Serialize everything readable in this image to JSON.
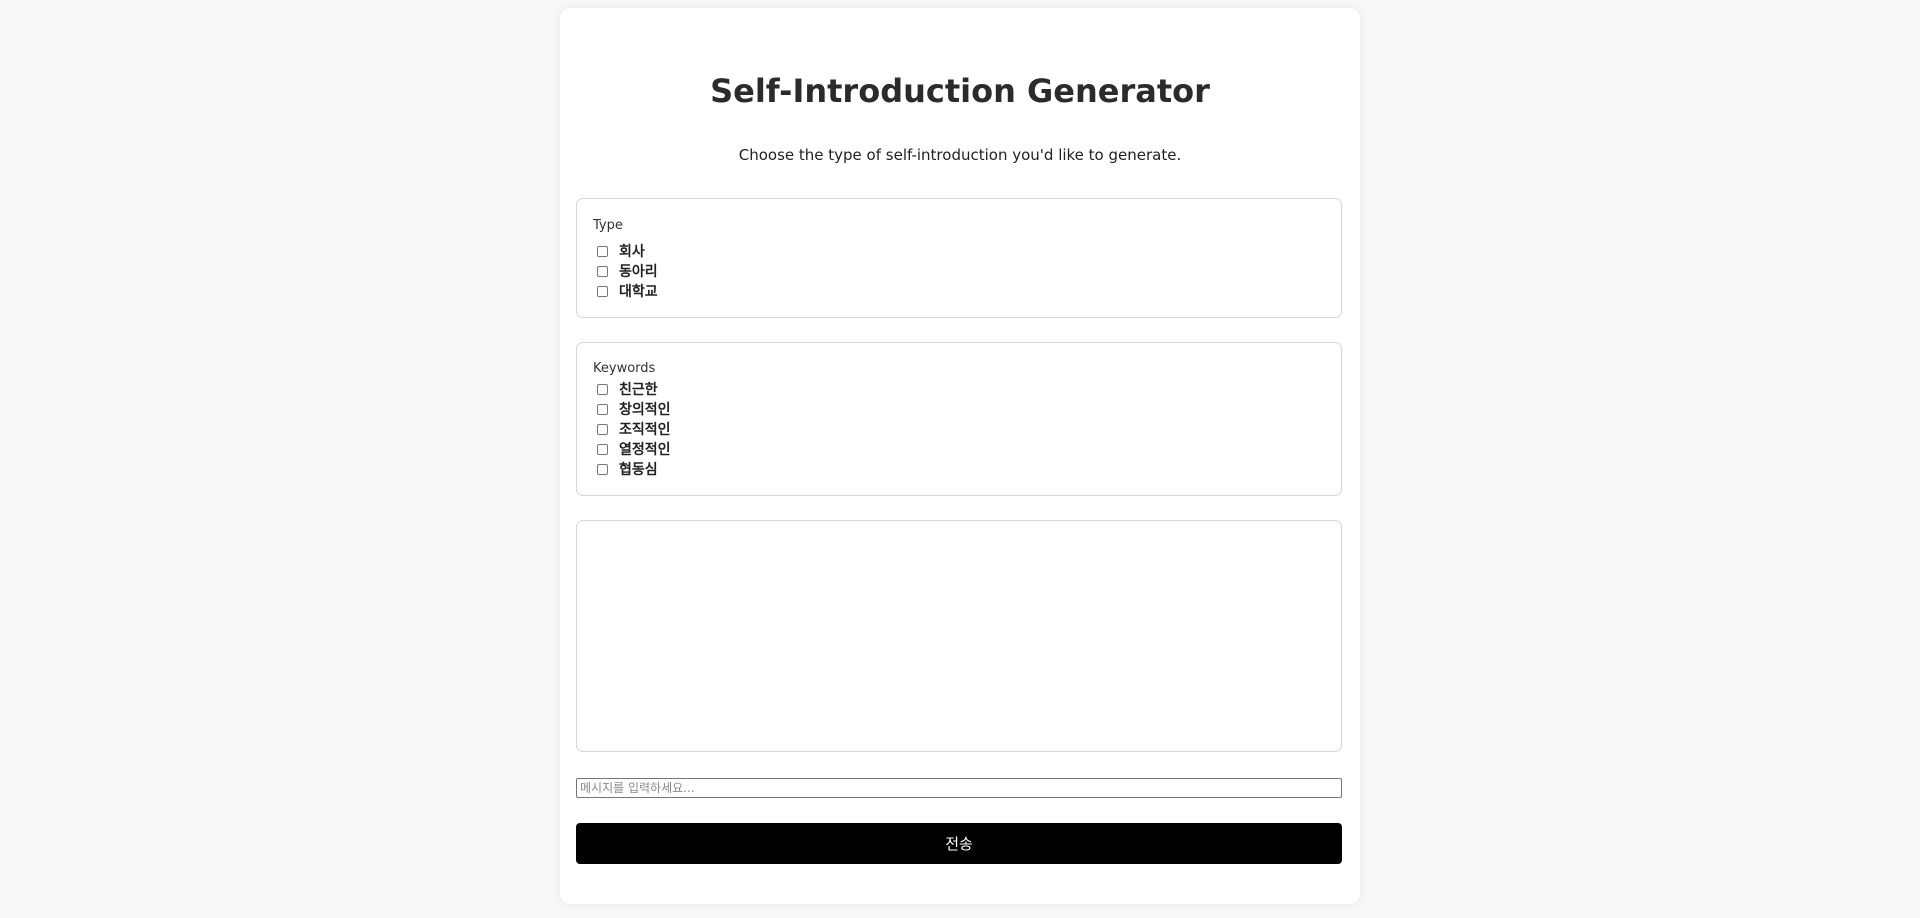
{
  "header": {
    "title": "Self-Introduction Generator",
    "subtitle": "Choose the type of self-introduction you'd like to generate."
  },
  "type_group": {
    "legend": "Type",
    "options": [
      {
        "label": "회사",
        "checked": false
      },
      {
        "label": "동아리",
        "checked": false
      },
      {
        "label": "대학교",
        "checked": false
      }
    ]
  },
  "keywords_group": {
    "legend": "Keywords",
    "options": [
      {
        "label": "친근한",
        "checked": false
      },
      {
        "label": "창의적인",
        "checked": false
      },
      {
        "label": "조직적인",
        "checked": false
      },
      {
        "label": "열정적인",
        "checked": false
      },
      {
        "label": "협동심",
        "checked": false
      }
    ]
  },
  "chat": {
    "messages": []
  },
  "message_input": {
    "value": "",
    "placeholder": "메시지를 입력하세요..."
  },
  "send_button": {
    "label": "전송"
  },
  "colors": {
    "background": "#f8f8f8",
    "card": "#ffffff",
    "button": "#000000",
    "button_text": "#ffffff"
  }
}
